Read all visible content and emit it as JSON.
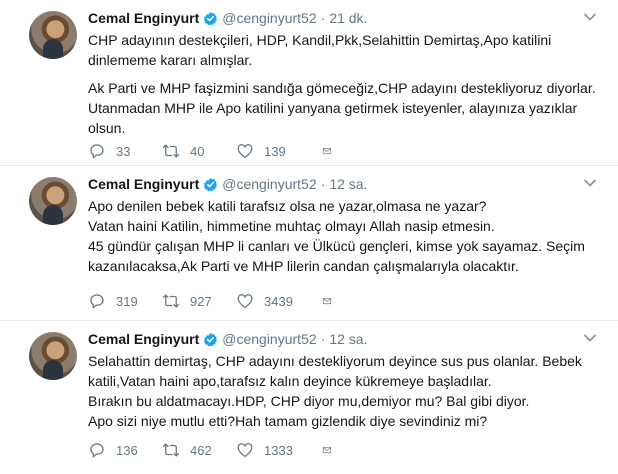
{
  "tweets": [
    {
      "author_name": "Cemal Enginyurt",
      "handle": "@cenginyurt52",
      "separator": "·",
      "time": "21 dk.",
      "lines": [
        "CHP adayının destekçileri, HDP, Kandil,Pkk,Selahittin Demirtaş,Apo katilini",
        "dinlememe kararı almışlar.",
        "Ak Parti ve MHP faşizmini sandığa gömeceğiz,CHP adayını destekliyoruz diyorlar.",
        "Utanmadan MHP ile Apo katilini yanyana getirmek isteyenler, alayınıza yazıklar",
        "olsun."
      ],
      "replies": "33",
      "retweets": "40",
      "likes": "139"
    },
    {
      "author_name": "Cemal Enginyurt",
      "handle": "@cenginyurt52",
      "separator": "·",
      "time": "12 sa.",
      "lines": [
        "Apo denilen bebek katili tarafsız olsa ne yazar,olmasa ne yazar?",
        "Vatan haini Katilin, himmetine muhtaç olmayı Allah nasip etmesin.",
        "45 gündür çalışan MHP li canları ve Ülkücü gençleri, kimse yok sayamaz. Seçim",
        "kazanılacaksa,Ak Parti ve MHP lilerin candan çalışmalarıyla olacaktır."
      ],
      "replies": "319",
      "retweets": "927",
      "likes": "3439"
    },
    {
      "author_name": "Cemal Enginyurt",
      "handle": "@cenginyurt52",
      "separator": "·",
      "time": "12 sa.",
      "lines": [
        "Selahattin demirtaş, CHP adayını destekliyorum deyince sus pus olanlar. Bebek",
        "katili,Vatan haini apo,tarafsız kalın deyince kükremeye başladılar.",
        "Bırakın bu aldatmacayı.HDP, CHP diyor mu,demiyor mu? Bal gibi diyor.",
        "Apo sizi niye mutlu etti?Hah tamam gizlendik diye sevindiniz mi?"
      ],
      "replies": "136",
      "retweets": "462",
      "likes": "1333"
    }
  ],
  "colors": {
    "verified": "#1da1f2",
    "secondary_text": "#657786",
    "primary_text": "#14171a",
    "divider": "#e6ecf0"
  },
  "icons": {
    "verified": "verified-badge-icon",
    "caret": "chevron-down-icon",
    "reply": "reply-icon",
    "retweet": "retweet-icon",
    "like": "heart-icon",
    "dm": "envelope-icon"
  }
}
